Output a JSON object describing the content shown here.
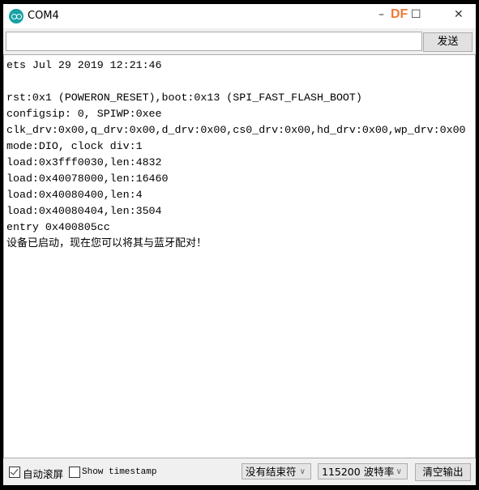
{
  "window": {
    "title": "COM4",
    "logo_icon": "arduino-logo-icon",
    "watermark": "DF"
  },
  "send": {
    "input_value": "",
    "button_label": "发送"
  },
  "output": {
    "lines": [
      "ets Jul 29 2019 12:21:46",
      "",
      "rst:0x1 (POWERON_RESET),boot:0x13 (SPI_FAST_FLASH_BOOT)",
      "configsip: 0, SPIWP:0xee",
      "clk_drv:0x00,q_drv:0x00,d_drv:0x00,cs0_drv:0x00,hd_drv:0x00,wp_drv:0x00",
      "mode:DIO, clock div:1",
      "load:0x3fff0030,len:4832",
      "load:0x40078000,len:16460",
      "load:0x40080400,len:4",
      "load:0x40080404,len:3504",
      "entry 0x400805cc",
      "设备已启动，现在您可以将其与蓝牙配对！"
    ]
  },
  "footer": {
    "autoscroll": {
      "label": "自动滚屏",
      "checked": true
    },
    "timestamp": {
      "label": "Show timestamp",
      "checked": false
    },
    "line_ending": "没有结束符",
    "baud_rate": "115200 波特率",
    "clear_label": "清空输出"
  }
}
